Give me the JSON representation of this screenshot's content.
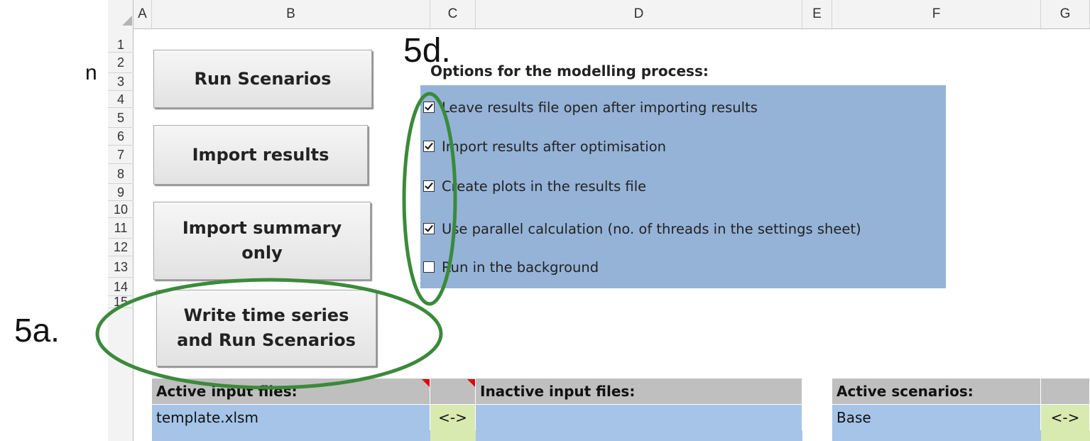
{
  "edge_text": "n",
  "columns": [
    "A",
    "B",
    "C",
    "D",
    "E",
    "F",
    "G"
  ],
  "rows": [
    "1",
    "2",
    "3",
    "4",
    "5",
    "6",
    "7",
    "8",
    "9",
    "10",
    "11",
    "12",
    "13",
    "14",
    "15"
  ],
  "buttons": {
    "run": "Run Scenarios",
    "import_results": "Import results",
    "import_summary": "Import summary\nonly",
    "write_run": "Write time series\nand Run Scenarios"
  },
  "options": {
    "title": "Options for the modelling process:",
    "items": [
      {
        "label": "Leave results file open after importing results",
        "checked": true
      },
      {
        "label": "Import results after optimisation",
        "checked": true
      },
      {
        "label": "Create plots in the results file",
        "checked": true
      },
      {
        "label": "Use parallel calculation (no. of threads in the settings sheet)",
        "checked": true
      },
      {
        "label": "Run in the background",
        "checked": false
      }
    ]
  },
  "annotations": {
    "label_5d": "5d.",
    "label_5a": "5a."
  },
  "tables": {
    "active_inputs_header": "Active input files:",
    "inactive_inputs_header": "Inactive input files:",
    "active_scenarios_header": "Active scenarios:",
    "active_input_row1": "template.xlsm",
    "swap_symbol": "<->",
    "active_scenario_row1": "Base"
  },
  "colors": {
    "options_panel": "#95b3d7",
    "table_cell": "#a6c4e8",
    "swap_cell": "#d8eab0",
    "annotation_ring": "#3a8a3a"
  }
}
